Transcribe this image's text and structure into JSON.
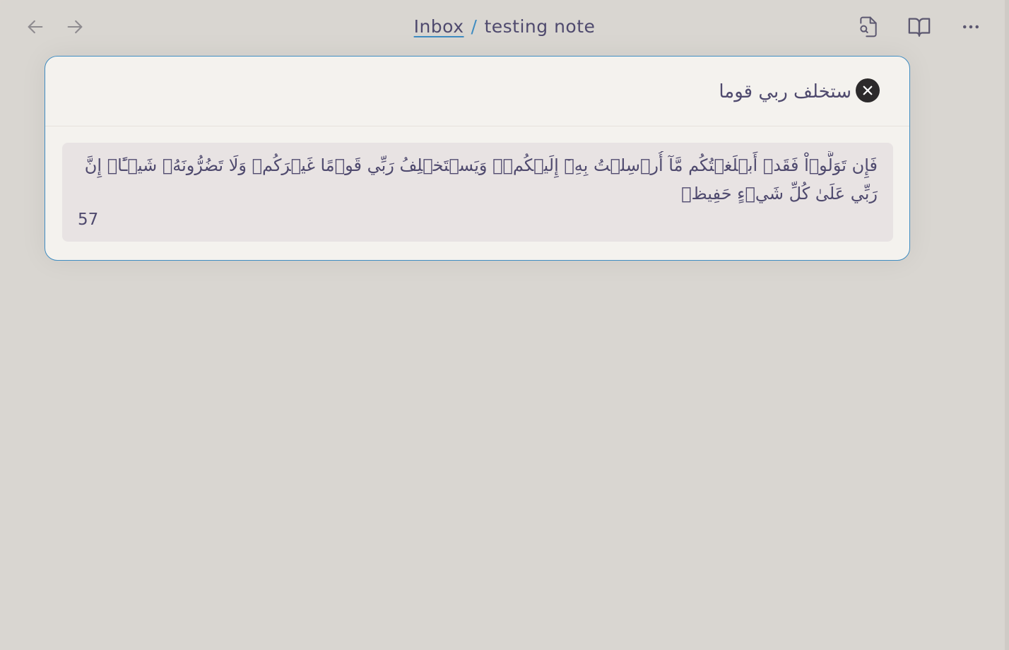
{
  "header": {
    "back_icon": "arrow-left-icon",
    "forward_icon": "arrow-right-icon",
    "breadcrumb": {
      "folder": "Inbox",
      "separator": "/",
      "note": "testing note"
    },
    "actions": [
      {
        "icon": "file-search-icon"
      },
      {
        "icon": "book-open-icon"
      },
      {
        "icon": "more-horizontal-icon"
      }
    ]
  },
  "search": {
    "query": "ستخلف ربي قوما",
    "clear_icon": "close-circle-icon"
  },
  "results": [
    {
      "text": "فَإِن تَوَلَّوۡاْ فَقَدۡ أَبۡلَغۡتُكُم مَّآ أُرۡسِلۡتُ بِهِۦٓ إِلَيۡكُمۡۚ وَيَسۡتَخۡلِفُ رَبِّي قَوۡمًا غَيۡرَكُمۡ وَلَا تَضُرُّونَهُۥ شَيۡـًٔاۚ إِنَّ رَبِّي عَلَىٰ كُلِّ شَيۡءٍ حَفِيظٞ",
      "meta": "57"
    }
  ],
  "colors": {
    "accent": "#3f8cc1",
    "text": "#4f4a6e",
    "background": "#d9d6d1",
    "modal": "#f4f2ee",
    "result": "#e8e3e3"
  }
}
